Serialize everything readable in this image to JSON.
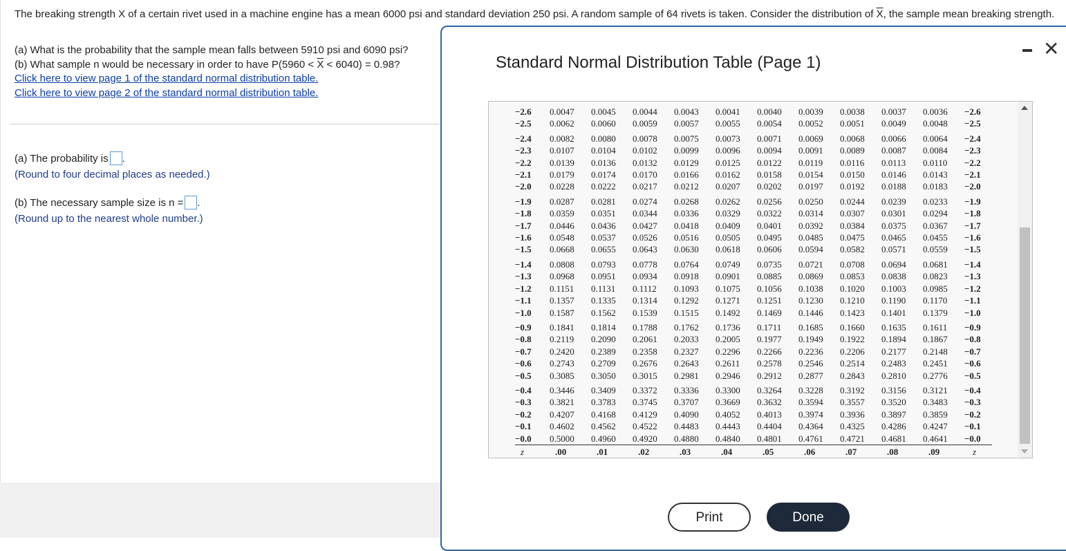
{
  "intro": {
    "prefix": "The breaking strength X of a certain rivet used in a machine engine has a mean 6000 psi and standard deviation 250 psi. A random sample of 64 rivets is taken. Consider the distribution of ",
    "xbar": "X",
    "suffix": ", the sample mean breaking strength."
  },
  "questions": {
    "a": "(a) What is the probability that the sample mean falls between 5910 psi and 6090 psi?",
    "b_prefix": "(b) What sample n would be necessary in order to have P(5960 < ",
    "b_xbar": "X",
    "b_suffix": " < 6040) = 0.98?",
    "link1": "Click here to view page 1 of the standard normal distribution table.",
    "link2": "Click here to view page 2 of the standard normal distribution table."
  },
  "answers": {
    "a_label": "(a) The probability is",
    "a_hint": "(Round to four decimal places as needed.)",
    "b_label": "(b) The necessary sample size is n =",
    "b_hint": "(Round up to the nearest whole number.)"
  },
  "dialog": {
    "title": "Standard Normal Distribution Table (Page 1)",
    "print_label": "Print",
    "done_label": "Done",
    "minimize_icon": "minimize-icon",
    "close_icon": "close-icon",
    "close_glyph": "✕"
  },
  "table": {
    "header": [
      "z",
      ".00",
      ".01",
      ".02",
      ".03",
      ".04",
      ".05",
      ".06",
      ".07",
      ".08",
      ".09",
      "z"
    ],
    "groups": [
      [
        [
          "−2.6",
          "0.0047",
          "0.0045",
          "0.0044",
          "0.0043",
          "0.0041",
          "0.0040",
          "0.0039",
          "0.0038",
          "0.0037",
          "0.0036",
          "−2.6"
        ],
        [
          "−2.5",
          "0.0062",
          "0.0060",
          "0.0059",
          "0.0057",
          "0.0055",
          "0.0054",
          "0.0052",
          "0.0051",
          "0.0049",
          "0.0048",
          "−2.5"
        ]
      ],
      [
        [
          "−2.4",
          "0.0082",
          "0.0080",
          "0.0078",
          "0.0075",
          "0.0073",
          "0.0071",
          "0.0069",
          "0.0068",
          "0.0066",
          "0.0064",
          "−2.4"
        ],
        [
          "−2.3",
          "0.0107",
          "0.0104",
          "0.0102",
          "0.0099",
          "0.0096",
          "0.0094",
          "0.0091",
          "0.0089",
          "0.0087",
          "0.0084",
          "−2.3"
        ],
        [
          "−2.2",
          "0.0139",
          "0.0136",
          "0.0132",
          "0.0129",
          "0.0125",
          "0.0122",
          "0.0119",
          "0.0116",
          "0.0113",
          "0.0110",
          "−2.2"
        ],
        [
          "−2.1",
          "0.0179",
          "0.0174",
          "0.0170",
          "0.0166",
          "0.0162",
          "0.0158",
          "0.0154",
          "0.0150",
          "0.0146",
          "0.0143",
          "−2.1"
        ],
        [
          "−2.0",
          "0.0228",
          "0.0222",
          "0.0217",
          "0.0212",
          "0.0207",
          "0.0202",
          "0.0197",
          "0.0192",
          "0.0188",
          "0.0183",
          "−2.0"
        ]
      ],
      [
        [
          "−1.9",
          "0.0287",
          "0.0281",
          "0.0274",
          "0.0268",
          "0.0262",
          "0.0256",
          "0.0250",
          "0.0244",
          "0.0239",
          "0.0233",
          "−1.9"
        ],
        [
          "−1.8",
          "0.0359",
          "0.0351",
          "0.0344",
          "0.0336",
          "0.0329",
          "0.0322",
          "0.0314",
          "0.0307",
          "0.0301",
          "0.0294",
          "−1.8"
        ],
        [
          "−1.7",
          "0.0446",
          "0.0436",
          "0.0427",
          "0.0418",
          "0.0409",
          "0.0401",
          "0.0392",
          "0.0384",
          "0.0375",
          "0.0367",
          "−1.7"
        ],
        [
          "−1.6",
          "0.0548",
          "0.0537",
          "0.0526",
          "0.0516",
          "0.0505",
          "0.0495",
          "0.0485",
          "0.0475",
          "0.0465",
          "0.0455",
          "−1.6"
        ],
        [
          "−1.5",
          "0.0668",
          "0.0655",
          "0.0643",
          "0.0630",
          "0.0618",
          "0.0606",
          "0.0594",
          "0.0582",
          "0.0571",
          "0.0559",
          "−1.5"
        ]
      ],
      [
        [
          "−1.4",
          "0.0808",
          "0.0793",
          "0.0778",
          "0.0764",
          "0.0749",
          "0.0735",
          "0.0721",
          "0.0708",
          "0.0694",
          "0.0681",
          "−1.4"
        ],
        [
          "−1.3",
          "0.0968",
          "0.0951",
          "0.0934",
          "0.0918",
          "0.0901",
          "0.0885",
          "0.0869",
          "0.0853",
          "0.0838",
          "0.0823",
          "−1.3"
        ],
        [
          "−1.2",
          "0.1151",
          "0.1131",
          "0.1112",
          "0.1093",
          "0.1075",
          "0.1056",
          "0.1038",
          "0.1020",
          "0.1003",
          "0.0985",
          "−1.2"
        ],
        [
          "−1.1",
          "0.1357",
          "0.1335",
          "0.1314",
          "0.1292",
          "0.1271",
          "0.1251",
          "0.1230",
          "0.1210",
          "0.1190",
          "0.1170",
          "−1.1"
        ],
        [
          "−1.0",
          "0.1587",
          "0.1562",
          "0.1539",
          "0.1515",
          "0.1492",
          "0.1469",
          "0.1446",
          "0.1423",
          "0.1401",
          "0.1379",
          "−1.0"
        ]
      ],
      [
        [
          "−0.9",
          "0.1841",
          "0.1814",
          "0.1788",
          "0.1762",
          "0.1736",
          "0.1711",
          "0.1685",
          "0.1660",
          "0.1635",
          "0.1611",
          "−0.9"
        ],
        [
          "−0.8",
          "0.2119",
          "0.2090",
          "0.2061",
          "0.2033",
          "0.2005",
          "0.1977",
          "0.1949",
          "0.1922",
          "0.1894",
          "0.1867",
          "−0.8"
        ],
        [
          "−0.7",
          "0.2420",
          "0.2389",
          "0.2358",
          "0.2327",
          "0.2296",
          "0.2266",
          "0.2236",
          "0.2206",
          "0.2177",
          "0.2148",
          "−0.7"
        ],
        [
          "−0.6",
          "0.2743",
          "0.2709",
          "0.2676",
          "0.2643",
          "0.2611",
          "0.2578",
          "0.2546",
          "0.2514",
          "0.2483",
          "0.2451",
          "−0.6"
        ],
        [
          "−0.5",
          "0.3085",
          "0.3050",
          "0.3015",
          "0.2981",
          "0.2946",
          "0.2912",
          "0.2877",
          "0.2843",
          "0.2810",
          "0.2776",
          "−0.5"
        ]
      ],
      [
        [
          "−0.4",
          "0.3446",
          "0.3409",
          "0.3372",
          "0.3336",
          "0.3300",
          "0.3264",
          "0.3228",
          "0.3192",
          "0.3156",
          "0.3121",
          "−0.4"
        ],
        [
          "−0.3",
          "0.3821",
          "0.3783",
          "0.3745",
          "0.3707",
          "0.3669",
          "0.3632",
          "0.3594",
          "0.3557",
          "0.3520",
          "0.3483",
          "−0.3"
        ],
        [
          "−0.2",
          "0.4207",
          "0.4168",
          "0.4129",
          "0.4090",
          "0.4052",
          "0.4013",
          "0.3974",
          "0.3936",
          "0.3897",
          "0.3859",
          "−0.2"
        ],
        [
          "−0.1",
          "0.4602",
          "0.4562",
          "0.4522",
          "0.4483",
          "0.4443",
          "0.4404",
          "0.4364",
          "0.4325",
          "0.4286",
          "0.4247",
          "−0.1"
        ],
        [
          "−0.0",
          "0.5000",
          "0.4960",
          "0.4920",
          "0.4880",
          "0.4840",
          "0.4801",
          "0.4761",
          "0.4721",
          "0.4681",
          "0.4641",
          "−0.0"
        ]
      ]
    ]
  }
}
